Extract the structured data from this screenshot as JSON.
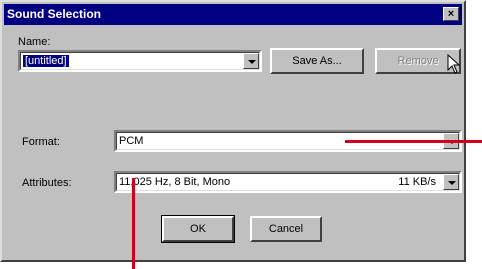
{
  "window": {
    "title": "Sound Selection",
    "close_glyph": "×"
  },
  "name": {
    "label": "Name:",
    "value": "[untitled]"
  },
  "buttons": {
    "save_as": "Save As...",
    "remove": "Remove",
    "ok": "OK",
    "cancel": "Cancel"
  },
  "format": {
    "label": "Format:",
    "value": "PCM"
  },
  "attributes": {
    "label": "Attributes:",
    "value": "11,025 Hz, 8 Bit, Mono",
    "rate": "11 KB/s"
  },
  "colors": {
    "title_bar": "#000080",
    "dialog_face": "#c0c0c0",
    "annotation_line": "#d0001c"
  }
}
